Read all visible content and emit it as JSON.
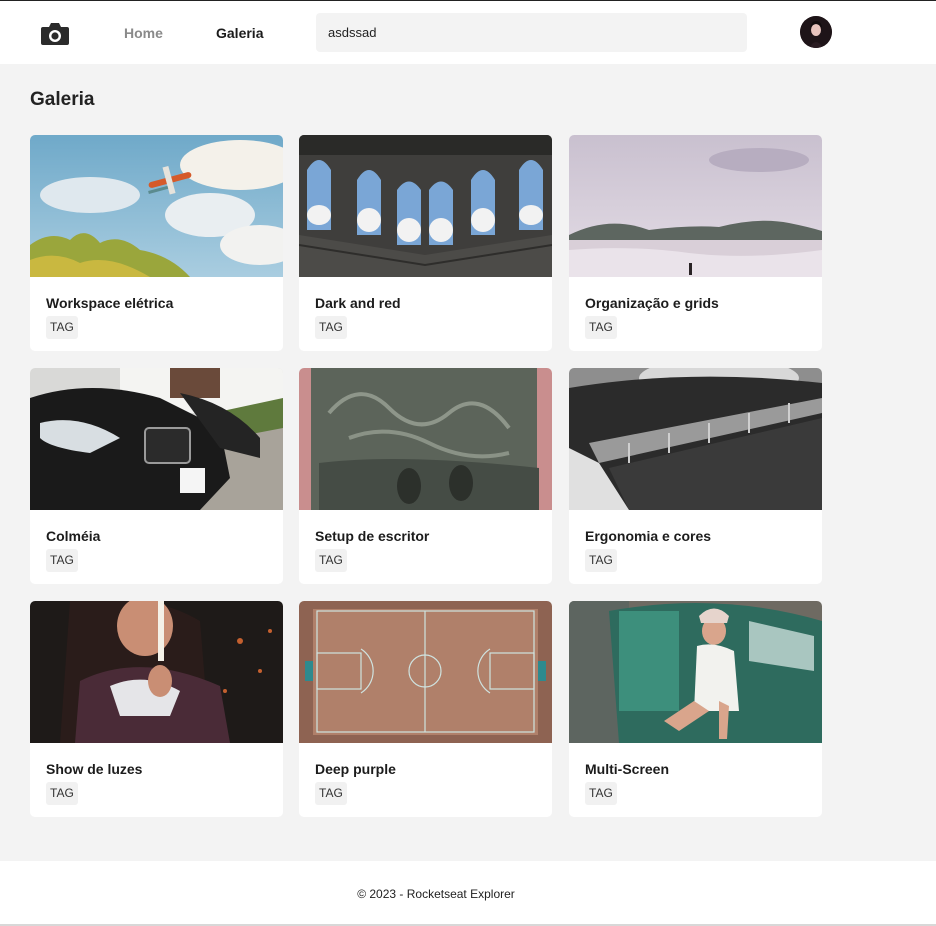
{
  "header": {
    "logo_icon": "camera-icon",
    "nav": {
      "home_label": "Home",
      "gallery_label": "Galeria"
    },
    "search": {
      "value": "asdssad"
    },
    "avatar_icon": "user-avatar"
  },
  "page": {
    "title": "Galeria"
  },
  "cards": [
    {
      "title": "Workspace elétrica",
      "tag": "TAG",
      "image": "seaplane-sky-photo"
    },
    {
      "title": "Dark and red",
      "tag": "TAG",
      "image": "arched-windows-photo"
    },
    {
      "title": "Organização e grids",
      "tag": "TAG",
      "image": "misty-beach-photo"
    },
    {
      "title": "Colméia",
      "tag": "TAG",
      "image": "parked-cars-photo"
    },
    {
      "title": "Setup de escritor",
      "tag": "TAG",
      "image": "signature-slab-photo"
    },
    {
      "title": "Ergonomia e cores",
      "tag": "TAG",
      "image": "modern-building-photo"
    },
    {
      "title": "Show de luzes",
      "tag": "TAG",
      "image": "candle-woman-photo"
    },
    {
      "title": "Deep purple",
      "tag": "TAG",
      "image": "basketball-court-photo"
    },
    {
      "title": "Multi-Screen",
      "tag": "TAG",
      "image": "vintage-car-woman-photo"
    }
  ],
  "footer": {
    "copyright": "© 2023 - Rocketseat Explorer"
  },
  "colors": {
    "background": "#f3f3f3",
    "surface": "#ffffff",
    "text": "#1c1c1c",
    "muted": "#8a8a8a"
  }
}
